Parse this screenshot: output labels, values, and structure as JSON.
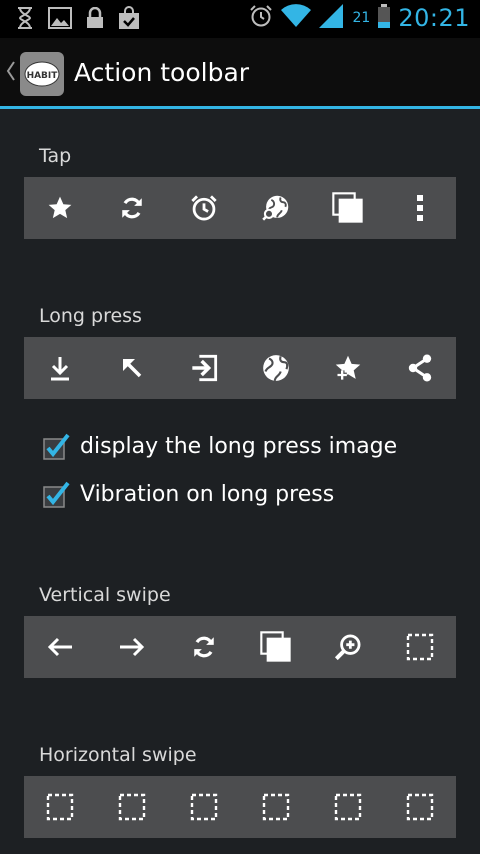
{
  "status_bar": {
    "battery_level": "21",
    "time": "20:21",
    "accent_color": "#33b5e5",
    "icons_left": [
      "hourglass-icon",
      "image-icon",
      "lock-icon",
      "shopping-bag-icon"
    ],
    "icons_right": [
      "alarm-icon",
      "wifi-icon",
      "signal-icon",
      "battery-icon"
    ]
  },
  "action_bar": {
    "title": "Action toolbar",
    "logo_text": "HABIT"
  },
  "sections": {
    "tap": {
      "label": "Tap",
      "icons": [
        "star-icon",
        "refresh-icon",
        "alarm-clock-icon",
        "globe-search-icon",
        "copy-icon",
        "overflow-menu-icon"
      ]
    },
    "long_press": {
      "label": "Long press",
      "icons": [
        "download-icon",
        "arrow-up-left-icon",
        "login-icon",
        "globe-icon",
        "star-add-icon",
        "share-icon"
      ]
    },
    "vertical_swipe": {
      "label": "Vertical swipe",
      "icons": [
        "arrow-left-icon",
        "arrow-right-icon",
        "refresh-icon",
        "copy-icon",
        "zoom-in-icon",
        "empty-slot-icon"
      ]
    },
    "horizontal_swipe": {
      "label": "Horizontal swipe",
      "icons": [
        "empty-slot-icon",
        "empty-slot-icon",
        "empty-slot-icon",
        "empty-slot-icon",
        "empty-slot-icon",
        "empty-slot-icon"
      ]
    }
  },
  "options": {
    "display_long_press_image": {
      "label": "display the long press image",
      "checked": true
    },
    "vibration_on_long_press": {
      "label": "Vibration on long press",
      "checked": true
    }
  }
}
